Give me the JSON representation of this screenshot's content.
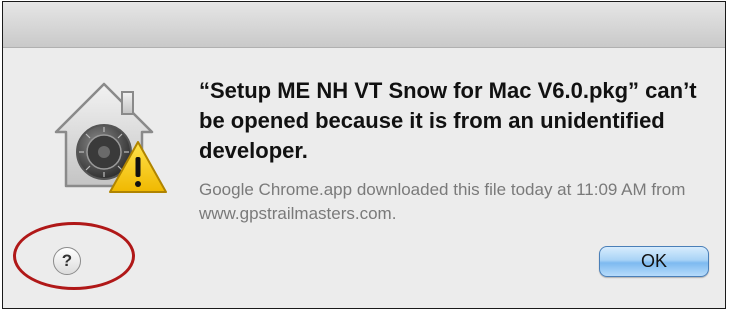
{
  "dialog": {
    "message": "“Setup ME NH VT Snow for Mac V6.0.pkg” can’t be opened because it is from an unidentified developer.",
    "detail": "Google Chrome.app downloaded this file today at 11:09 AM from www.gpstrailmasters.com.",
    "help_label": "?",
    "ok_label": "OK",
    "icon": "gatekeeper-warning-icon"
  },
  "colors": {
    "annotation_ring": "#b01818",
    "ok_button": "#7dbaf0",
    "warning": "#f5c800"
  }
}
